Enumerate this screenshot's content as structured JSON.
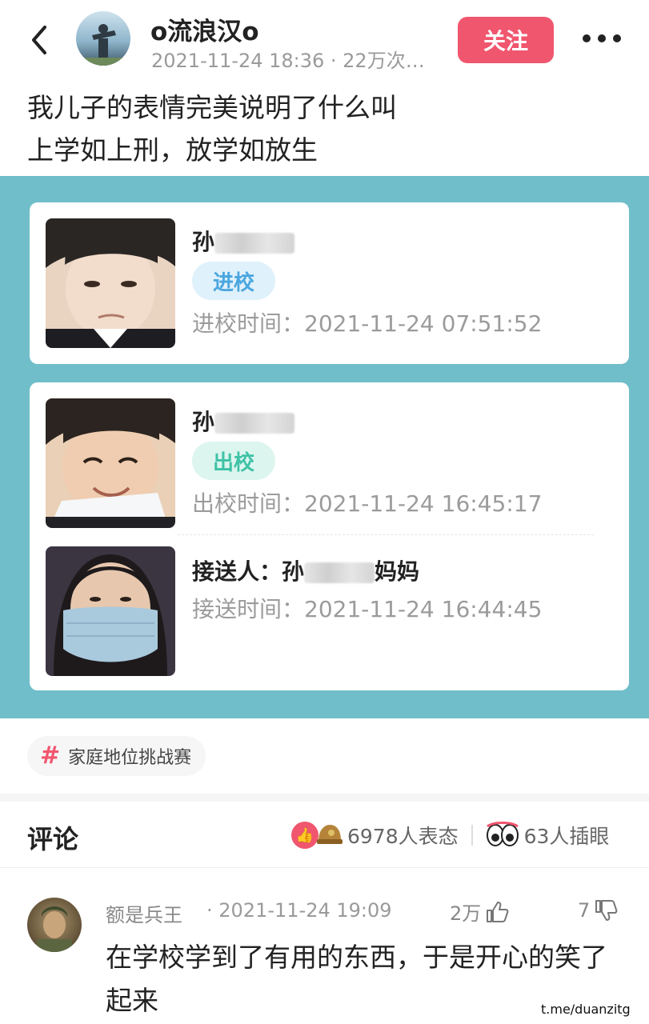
{
  "header": {
    "username": "o流浪汉o",
    "meta": "2021-11-24 18:36 · 22万次…",
    "follow_label": "关注"
  },
  "post": {
    "line1": "我儿子的表情完美说明了什么叫",
    "line2": "上学如上刑，放学如放生"
  },
  "card_entry": {
    "name_prefix": "孙",
    "status": "进校",
    "time_text": "进校时间：2021-11-24 07:51:52"
  },
  "card_exit": {
    "name_prefix": "孙",
    "status": "出校",
    "time_text": "出校时间：2021-11-24 16:45:17",
    "pickup_label": "接送人：孙",
    "pickup_suffix": "妈妈",
    "pickup_time_text": "接送时间：2021-11-24 16:44:45"
  },
  "hashtag": {
    "label": "家庭地位挑战赛"
  },
  "comments_header": {
    "title": "评论",
    "reactions": "6978人表态",
    "stickers": "63人插眼"
  },
  "comment": {
    "author": "额是兵王",
    "time": "· 2021-11-24 19:09",
    "likes": "2万",
    "dislikes": "7",
    "text": "在学校学到了有用的东西，于是开心的笑了起来"
  },
  "watermark": "t.me/duanzitg",
  "colors": {
    "accent": "#f0566e",
    "teal_background": "#6fbec9",
    "pill_in": "#4aa6df",
    "pill_out": "#3fc2a6"
  }
}
